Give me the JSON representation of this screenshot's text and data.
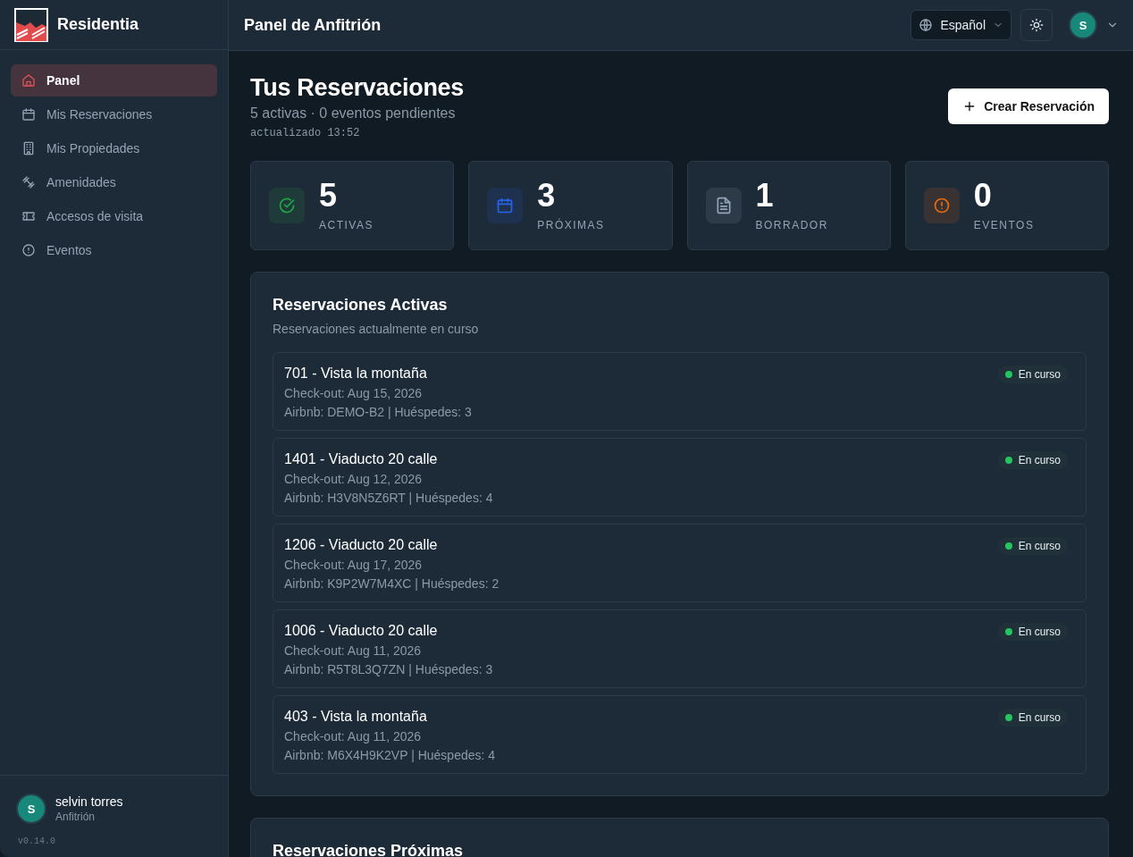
{
  "brand": {
    "name": "Residentia"
  },
  "sidebar": {
    "items": [
      {
        "label": "Panel",
        "kind": "home",
        "selected": true
      },
      {
        "label": "Mis Reservaciones",
        "kind": "calendar",
        "selected": false
      },
      {
        "label": "Mis Propiedades",
        "kind": "building",
        "selected": false
      },
      {
        "label": "Amenidades",
        "kind": "dumbbell",
        "selected": false
      },
      {
        "label": "Accesos de visita",
        "kind": "ticket",
        "selected": false
      },
      {
        "label": "Eventos",
        "kind": "alert",
        "selected": false
      }
    ],
    "user": {
      "initial": "S",
      "name": "selvin torres",
      "role": "Anfitrión"
    },
    "version": "v0.14.0"
  },
  "header": {
    "title": "Panel de Anfitrión",
    "language": "Español",
    "avatar": "S"
  },
  "page": {
    "title": "Tus Reservaciones",
    "subtitle": "5 activas · 0 eventos pendientes",
    "updated": "actualizado 13:52",
    "create_button": "Crear Reservación"
  },
  "stats": [
    {
      "value": "5",
      "label": "ACTIVAS",
      "kind": "check"
    },
    {
      "value": "3",
      "label": "PRÓXIMAS",
      "kind": "calendar"
    },
    {
      "value": "1",
      "label": "BORRADOR",
      "kind": "document"
    },
    {
      "value": "0",
      "label": "EVENTOS",
      "kind": "alert"
    }
  ],
  "active_section": {
    "title": "Reservaciones Activas",
    "subtitle": "Reservaciones actualmente en curso",
    "reservations": [
      {
        "title": "701 - Vista la montaña",
        "checkout": "Check-out: Aug 15, 2026",
        "details": "Airbnb: DEMO-B2 | Huéspedes: 3",
        "status": "En curso",
        "color": "#22c55e"
      },
      {
        "title": "1401 - Viaducto 20 calle",
        "checkout": "Check-out: Aug 12, 2026",
        "details": "Airbnb: H3V8N5Z6RT | Huéspedes: 4",
        "status": "En curso",
        "color": "#22c55e"
      },
      {
        "title": "1206 - Viaducto 20 calle",
        "checkout": "Check-out: Aug 17, 2026",
        "details": "Airbnb: K9P2W7M4XC | Huéspedes: 2",
        "status": "En curso",
        "color": "#22c55e"
      },
      {
        "title": "1006 - Viaducto 20 calle",
        "checkout": "Check-out: Aug 11, 2026",
        "details": "Airbnb: R5T8L3Q7ZN | Huéspedes: 3",
        "status": "En curso",
        "color": "#22c55e"
      },
      {
        "title": "403 - Vista la montaña",
        "checkout": "Check-out: Aug 11, 2026",
        "details": "Airbnb: M6X4H9K2VP | Huéspedes: 4",
        "status": "En curso",
        "color": "#22c55e"
      }
    ]
  },
  "upcoming_section": {
    "title": "Reservaciones Próximas"
  }
}
